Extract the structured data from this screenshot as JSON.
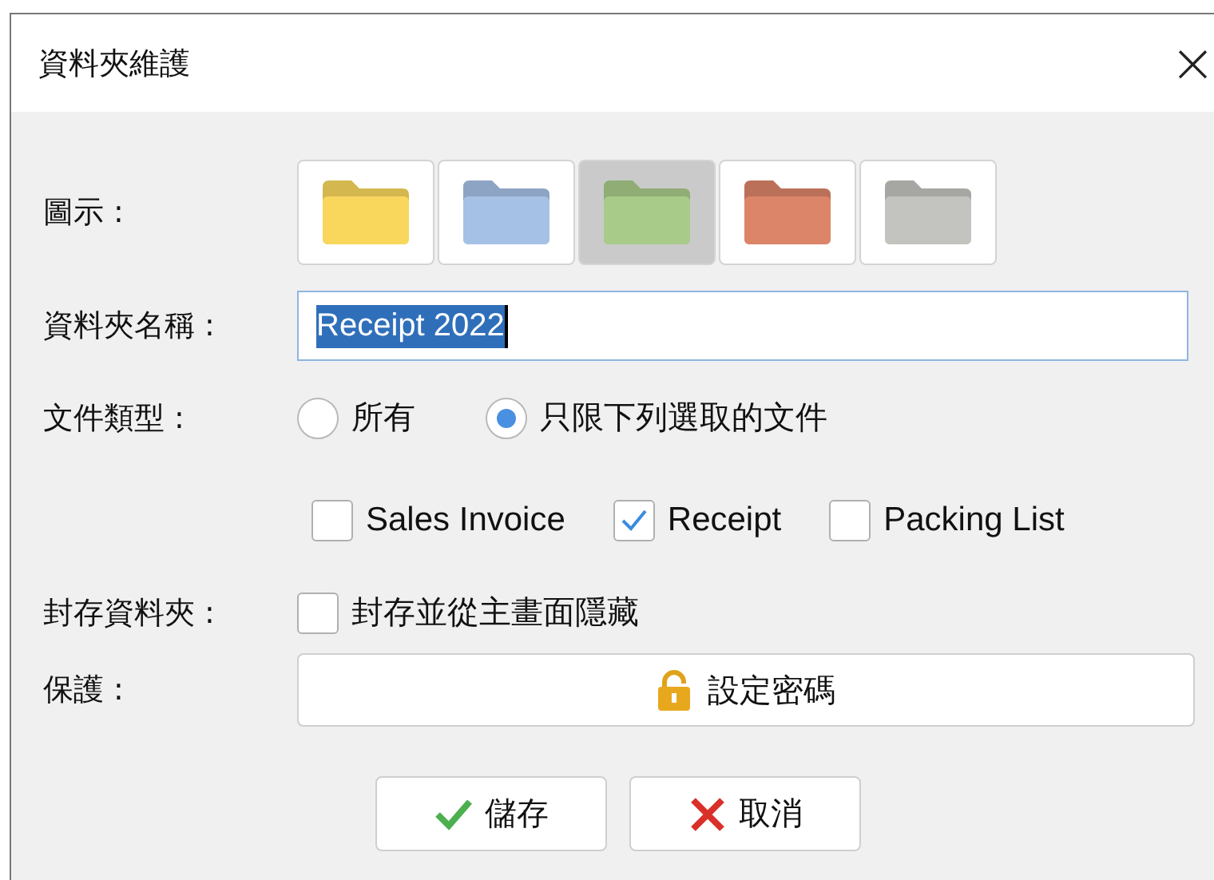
{
  "window": {
    "title": "資料夾維護",
    "close": "×"
  },
  "icon_row": {
    "label": "圖示 :",
    "folders": [
      {
        "color": "#f9d75d",
        "selected": false
      },
      {
        "color": "#a6c1e6",
        "selected": false
      },
      {
        "color": "#a8cb8a",
        "selected": true
      },
      {
        "color": "#dc8569",
        "selected": false
      },
      {
        "color": "#c3c3bf",
        "selected": false
      }
    ]
  },
  "folder_name": {
    "label": "資料夾名稱 :",
    "value": "Receipt 2022",
    "text_selected": true
  },
  "file_type": {
    "label": "文件類型 :",
    "options": [
      {
        "label": "所有",
        "selected": false
      },
      {
        "label": "只限下列選取的文件",
        "selected": true
      }
    ],
    "documents": [
      {
        "label": "Sales Invoice",
        "checked": false
      },
      {
        "label": "Receipt",
        "checked": true
      },
      {
        "label": "Packing List",
        "checked": false
      }
    ]
  },
  "archive": {
    "label": "封存資料夾 :",
    "option": {
      "label": "封存並從主畫面隱藏",
      "checked": false
    }
  },
  "protection": {
    "label": "保護 :",
    "button": "設定密碼"
  },
  "buttons": [
    {
      "kind": "save",
      "label": "儲存"
    },
    {
      "kind": "cancel",
      "label": "取消"
    }
  ]
}
